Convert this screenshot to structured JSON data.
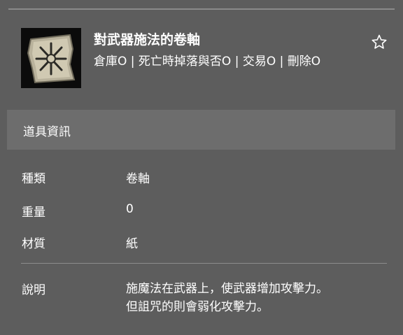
{
  "item": {
    "name": "對武器施法的卷軸",
    "flags": "倉庫O | 死亡時掉落與否O | 交易O | 刪除O",
    "icon": "scroll-icon",
    "favorite_icon": "star-outline-icon"
  },
  "section": {
    "title": "道具資訊"
  },
  "info": {
    "type_label": "種類",
    "type_value": "卷軸",
    "weight_label": "重量",
    "weight_value": "0",
    "material_label": "材質",
    "material_value": "紙",
    "desc_label": "說明",
    "desc_lines": [
      "施魔法在武器上，使武器增加攻擊力。",
      "但詛咒的則會弱化攻擊力。"
    ]
  },
  "colors": {
    "background": "#5d5d5d",
    "section_bar": "#6d6d6d",
    "text": "#ffffff"
  }
}
